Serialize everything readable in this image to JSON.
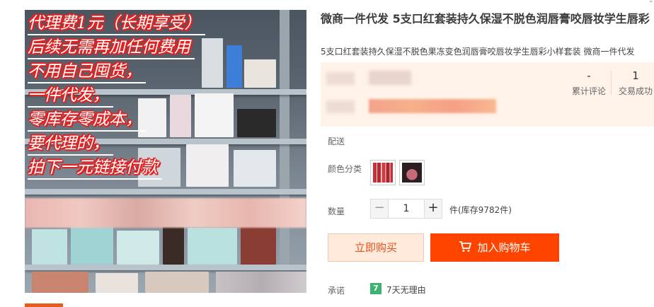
{
  "product": {
    "title": "微商一件代发 5支口红套装持久保湿不脱色润唇膏咬唇妆学生唇彩",
    "subtitle": "5支口红套装持久保湿不脱色果冻变色润唇膏咬唇妆学生唇彩小样套装 微商一件代发"
  },
  "image_overlay": {
    "lines": [
      "代理费1元（长期享受）",
      "后续无需再加任何费用",
      "不用自己囤货，",
      "一件代发，",
      "零库存零成本，",
      "要代理的，",
      "拍下一元链接付款"
    ],
    "text_color": "#ffffff",
    "outline_color": "#e32121"
  },
  "stats": {
    "reviews": {
      "value": "-",
      "label": "累计评论"
    },
    "transactions": {
      "value": "1",
      "label": "交易成功"
    }
  },
  "delivery_label": "配送",
  "color_label": "颜色分类",
  "quantity": {
    "label": "数量",
    "minus": "−",
    "value": "1",
    "plus": "+",
    "stock_text": "件(库存9782件)"
  },
  "buttons": {
    "buy_now": "立即购买",
    "add_to_cart": "加入购物车"
  },
  "promise": {
    "label": "承诺",
    "icon_text": "7",
    "text": "7天无理由"
  },
  "colors": {
    "accent": "#ff4400",
    "buy_text": "#e5511d",
    "price_bg": "#fff2e8",
    "promise_icon": "#3cb371"
  }
}
